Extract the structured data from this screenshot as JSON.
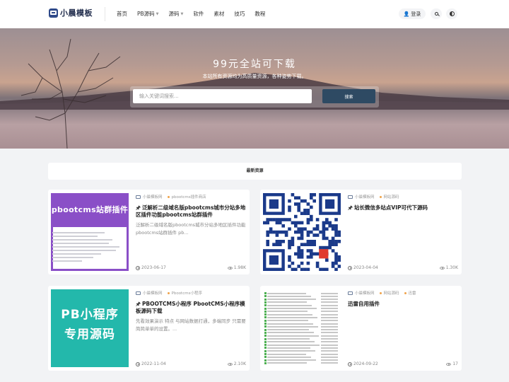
{
  "header": {
    "logo_text": "小晨模板",
    "nav": [
      {
        "label": "首页",
        "has_dropdown": false
      },
      {
        "label": "PB源码",
        "has_dropdown": true
      },
      {
        "label": "源码",
        "has_dropdown": true
      },
      {
        "label": "软件",
        "has_dropdown": false
      },
      {
        "label": "素材",
        "has_dropdown": false
      },
      {
        "label": "技巧",
        "has_dropdown": false
      },
      {
        "label": "教程",
        "has_dropdown": false
      }
    ],
    "login_label": "登录",
    "search_icon": "search-icon",
    "theme_icon": "theme-toggle-icon"
  },
  "hero": {
    "title": "99元全站可下载",
    "subtitle": "本站所有资源均为高质量资源，各种姿势下载。",
    "search_placeholder": "输入关键词搜索...",
    "search_button": "搜索"
  },
  "latest": {
    "title": "最新资源"
  },
  "cards": [
    {
      "author": "小晨模板网",
      "category": "pbootcms插件商店",
      "title": "泛解析二级域名版pbootcms城市分站多地区插件功能pbootcms站群插件",
      "desc": "泛解析二级域名版pbootcms城市分站多地区插件功能pbootcms站群插件 pb...",
      "date": "2023-06-17",
      "views": "1.98K",
      "thumb_text": "pbootcms站群插件"
    },
    {
      "author": "小晨模板网",
      "category": "网站源码",
      "title": "站长微信多站点VIP可代下源码",
      "desc": "",
      "date": "2023-04-04",
      "views": "1.30K",
      "thumb_text": ""
    },
    {
      "author": "小晨模板网",
      "category": "Pbootcms小程序",
      "title": "PBOOTCMS小程序 PbootCMS小程序模板源码下载",
      "desc": "先看效果演示   特点  与网站数据打通，多端同步 只需要简简单单的设置。...",
      "date": "2022-11-04",
      "views": "2.10K",
      "thumb_text": "PB小程序 专用源码"
    },
    {
      "author": "小晨模板网",
      "category": "网站源码",
      "tag": "迅雷",
      "title": "迅雷自用插件",
      "desc": "",
      "date": "2024-09-22",
      "views": "17",
      "thumb_text": ""
    }
  ]
}
